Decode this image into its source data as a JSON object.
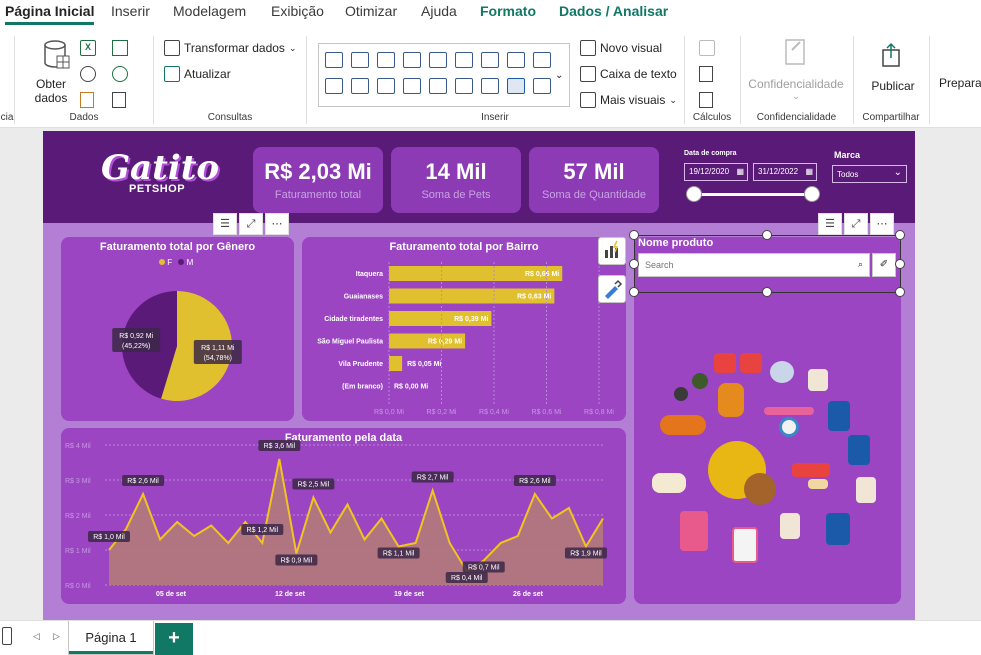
{
  "ribbon_tabs": [
    "Página Inicial",
    "Inserir",
    "Modelagem",
    "Exibição",
    "Otimizar",
    "Ajuda",
    "Formato",
    "Dados / Analisar"
  ],
  "ribbon": {
    "obter_dados": "Obter dados",
    "transformar": "Transformar dados",
    "atualizar": "Atualizar",
    "novo_visual": "Novo visual",
    "caixa_texto": "Caixa de texto",
    "mais_visuais": "Mais visuais",
    "confidencialidade": "Confidencialidade",
    "publicar": "Publicar",
    "preparar": "Preparar",
    "groups": {
      "dados": "Dados",
      "consultas": "Consultas",
      "inserir": "Inserir",
      "calculos": "Cálculos",
      "confid": "Confidencialidade",
      "compartilhar": "Compartilhar",
      "left_partial": "cia"
    }
  },
  "report": {
    "logo_main": "Gatito",
    "logo_sub": "PETSHOP",
    "kpis": [
      {
        "value": "R$ 2,03 Mi",
        "label": "Faturamento total"
      },
      {
        "value": "14 Mil",
        "label": "Soma de Pets"
      },
      {
        "value": "57 Mil",
        "label": "Soma de Quantidade"
      }
    ],
    "date_label": "Data de compra",
    "date_start": "19/12/2020",
    "date_end": "31/12/2022",
    "marca_label": "Marca",
    "marca_value": "Todos",
    "product_panel_title": "Nome produto",
    "search_placeholder": "Search"
  },
  "colors": {
    "dark_purple": "#5a1a78",
    "panel": "#9b45c2",
    "bg": "#b37fd4",
    "gold": "#e1c02f",
    "accent": "#117865"
  },
  "chart_data": [
    {
      "type": "pie",
      "title": "Faturamento total por Gênero",
      "legend": [
        "F",
        "M"
      ],
      "legend_placement": "top",
      "slices": [
        {
          "name": "F",
          "value": 1.11,
          "label": "R$ 1,11 Mi",
          "pct": "(54,78%)",
          "color": "#e1c02f"
        },
        {
          "name": "M",
          "value": 0.92,
          "label": "R$ 0,92 Mi",
          "pct": "(45,22%)",
          "color": "#5a1a78"
        }
      ]
    },
    {
      "type": "bar",
      "orientation": "horizontal",
      "title": "Faturamento total por Bairro",
      "categories": [
        "Itaquera",
        "Guaianases",
        "Cidade tiradentes",
        "São Miguel Paulista",
        "Vila Prudente",
        "(Em branco)"
      ],
      "values": [
        0.66,
        0.63,
        0.39,
        0.29,
        0.05,
        0.0
      ],
      "labels": [
        "R$ 0,66 Mi",
        "R$ 0,63 Mi",
        "R$ 0,39 Mi",
        "R$ 0,29 Mi",
        "R$ 0,05 Mi",
        "R$ 0,00 Mi"
      ],
      "xlim": [
        0,
        0.8
      ],
      "xticks": [
        "R$ 0,0 Mi",
        "R$ 0,2 Mi",
        "R$ 0,4 Mi",
        "R$ 0,6 Mi",
        "R$ 0,8 Mi"
      ]
    },
    {
      "type": "area",
      "title": "Faturamento pela data",
      "yticks": [
        "R$ 4 Mil",
        "R$ 3 Mil",
        "R$ 2 Mil",
        "R$ 1 Mil",
        "R$ 0 Mil"
      ],
      "ylim": [
        0,
        4
      ],
      "xticks": [
        "05 de set",
        "12 de set",
        "19 de set",
        "26 de set"
      ],
      "values": [
        1.0,
        1.6,
        2.6,
        1.3,
        1.8,
        1.4,
        1.7,
        1.2,
        1.8,
        1.2,
        3.6,
        0.9,
        2.5,
        1.5,
        2.3,
        1.3,
        1.9,
        1.1,
        1.2,
        2.7,
        1.2,
        0.4,
        0.7,
        1.2,
        1.4,
        2.6,
        1.9,
        2.2,
        1.1,
        1.9
      ],
      "annotations": [
        {
          "i": 0,
          "label": "R$ 1,0 Mil"
        },
        {
          "i": 2,
          "label": "R$ 2,6 Mil"
        },
        {
          "i": 9,
          "label": "R$ 1,2 Mil"
        },
        {
          "i": 10,
          "label": "R$ 3,6 Mil"
        },
        {
          "i": 11,
          "label": "R$ 0,9 Mil"
        },
        {
          "i": 12,
          "label": "R$ 2,5 Mil"
        },
        {
          "i": 17,
          "label": "R$ 1,1 Mil"
        },
        {
          "i": 19,
          "label": "R$ 2,7 Mil"
        },
        {
          "i": 21,
          "label": "R$ 0,4 Mil"
        },
        {
          "i": 22,
          "label": "R$ 0,7 Mil"
        },
        {
          "i": 25,
          "label": "R$ 2,6 Mil"
        },
        {
          "i": 28,
          "label": "R$ 1,9 Mil"
        }
      ]
    }
  ],
  "page_tab": "Página 1",
  "add_page": "+"
}
